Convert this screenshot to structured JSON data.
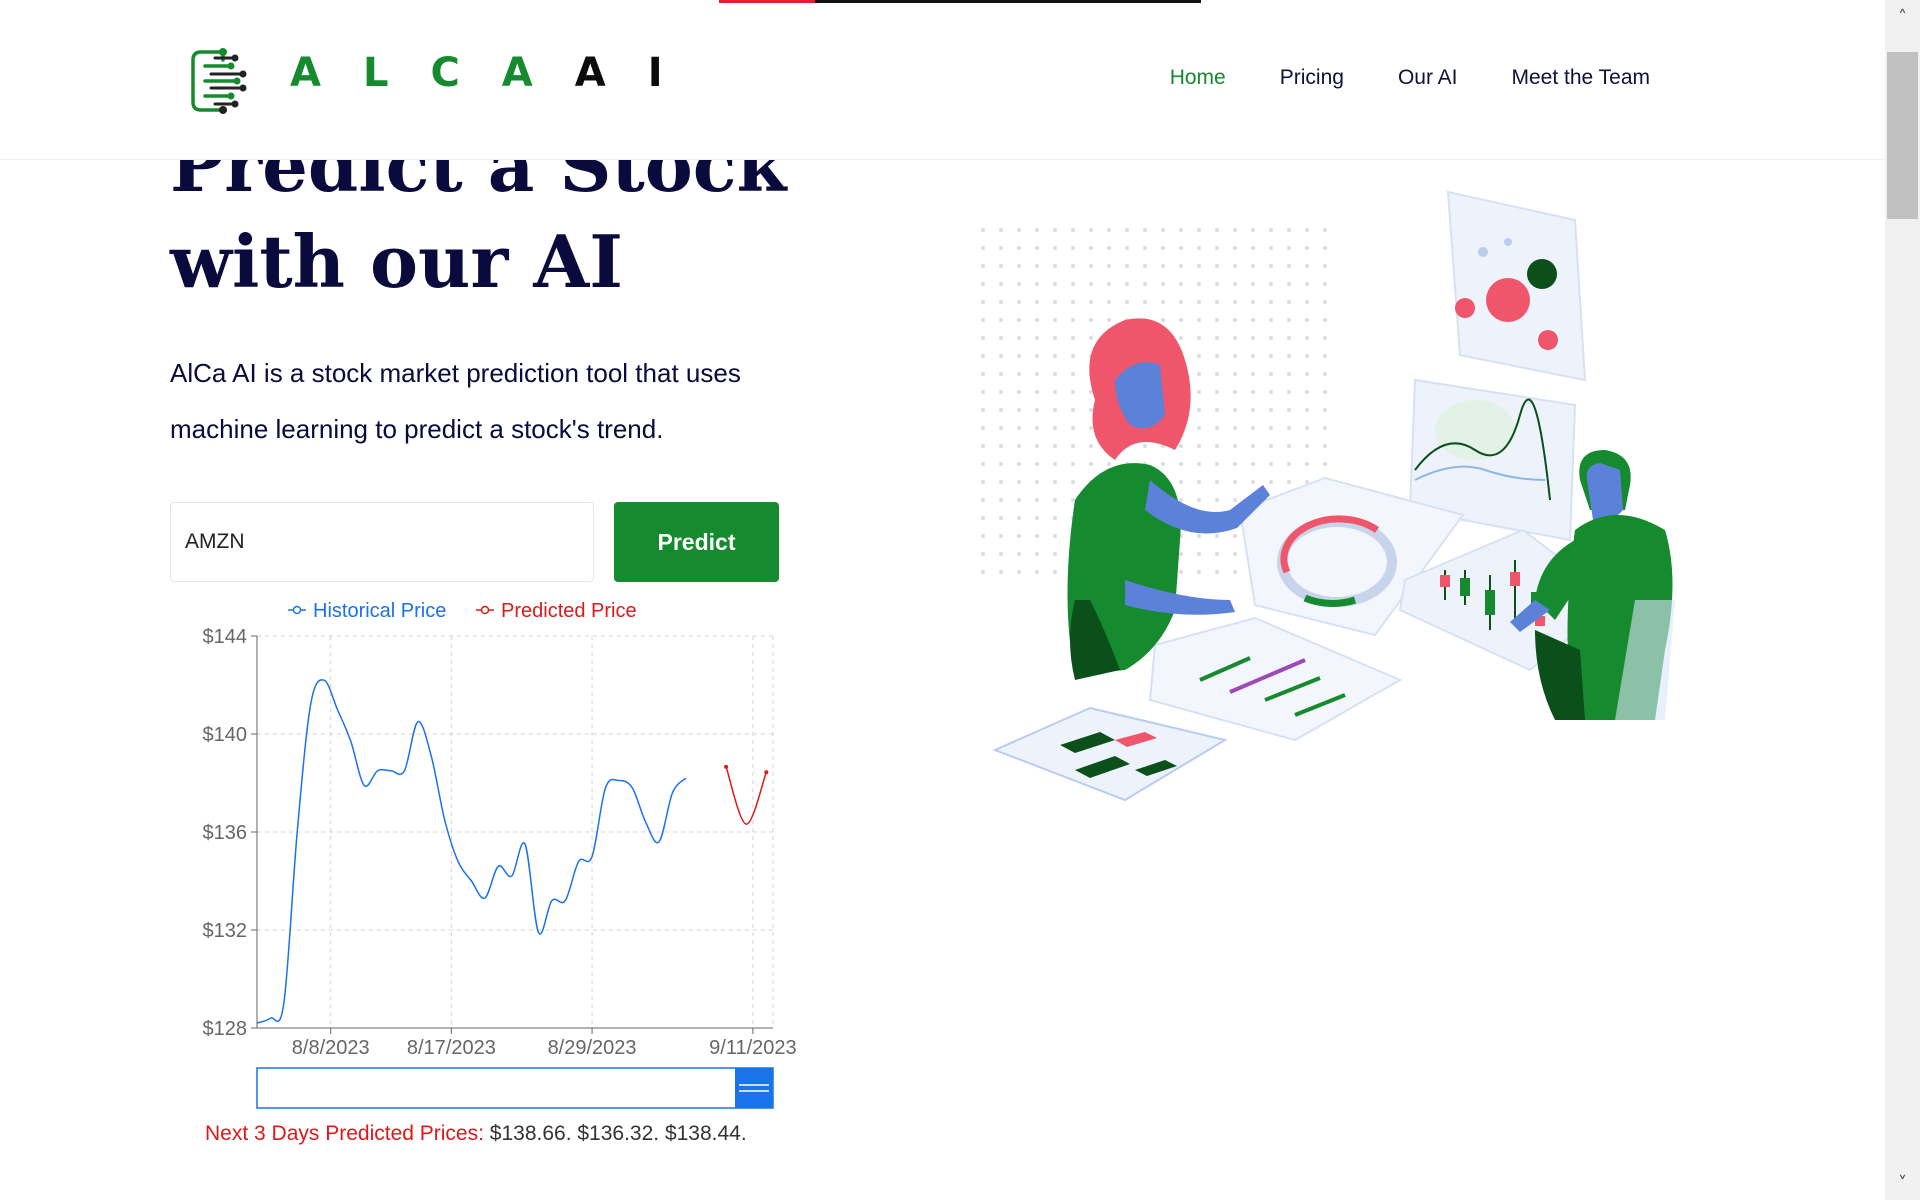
{
  "brand": {
    "name_green": "ALCA",
    "name_black": "AI"
  },
  "nav": {
    "items": [
      {
        "label": "Home",
        "active": true
      },
      {
        "label": "Pricing",
        "active": false
      },
      {
        "label": "Our AI",
        "active": false
      },
      {
        "label": "Meet the Team",
        "active": false
      }
    ]
  },
  "hero": {
    "title": "Predict a Stock with our AI",
    "description": "AlCa AI is a stock market prediction tool that uses machine learning to predict a stock's trend.",
    "ticker_value": "AMZN",
    "predict_label": "Predict"
  },
  "colors": {
    "brand_green": "#168a2e",
    "historical": "#1a73e8",
    "predicted": "#e01818",
    "loading_bar": "#e02030"
  },
  "loading_progress": 0.2,
  "chart_data": {
    "type": "line",
    "legend": [
      "Historical Price",
      "Predicted Price"
    ],
    "legend_position": "top",
    "y_ticks": [
      "$144",
      "$140",
      "$136",
      "$132",
      "$128"
    ],
    "y_tick_values": [
      144,
      140,
      136,
      132,
      128
    ],
    "ylim": [
      128,
      144
    ],
    "x_ticks": [
      "8/8/2023",
      "8/17/2023",
      "8/29/2023",
      "9/11/2023"
    ],
    "x_tick_positions": [
      6.5,
      15.5,
      26,
      38
    ],
    "xlim": [
      1,
      39.5
    ],
    "grid": true,
    "series": [
      {
        "name": "Historical Price",
        "points": [
          [
            1,
            128.2
          ],
          [
            2,
            128.4
          ],
          [
            3,
            129
          ],
          [
            4,
            136
          ],
          [
            5,
            141.2
          ],
          [
            6,
            142.2
          ],
          [
            7,
            141
          ],
          [
            8,
            139.7
          ],
          [
            9,
            137.9
          ],
          [
            10,
            138.5
          ],
          [
            11,
            138.5
          ],
          [
            12,
            138.5
          ],
          [
            13,
            140.5
          ],
          [
            14,
            139.1
          ],
          [
            15,
            136.5
          ],
          [
            16,
            134.8
          ],
          [
            17,
            134
          ],
          [
            18,
            133.3
          ],
          [
            19,
            134.6
          ],
          [
            20,
            134.2
          ],
          [
            21,
            135.5
          ],
          [
            22,
            131.9
          ],
          [
            23,
            133.2
          ],
          [
            24,
            133.2
          ],
          [
            25,
            134.8
          ],
          [
            26,
            135
          ],
          [
            27,
            137.8
          ],
          [
            28,
            138.1
          ],
          [
            29,
            137.8
          ],
          [
            30,
            136.4
          ],
          [
            31,
            135.6
          ],
          [
            32,
            137.6
          ],
          [
            33,
            138.2
          ]
        ]
      },
      {
        "name": "Predicted Price",
        "points": [
          [
            36,
            138.66
          ],
          [
            37.5,
            136.32
          ],
          [
            39,
            138.44
          ]
        ]
      }
    ],
    "range_slider": true,
    "range_handle_icon": "grip-lines-icon"
  },
  "prediction": {
    "label": "Next 3 Days Predicted Prices:",
    "values": "$138.66. $136.32. $138.44."
  },
  "icons": {
    "logo": "circuit-e-logo-icon",
    "scroll_up": "chevron-up-icon",
    "scroll_down": "chevron-down-icon"
  }
}
